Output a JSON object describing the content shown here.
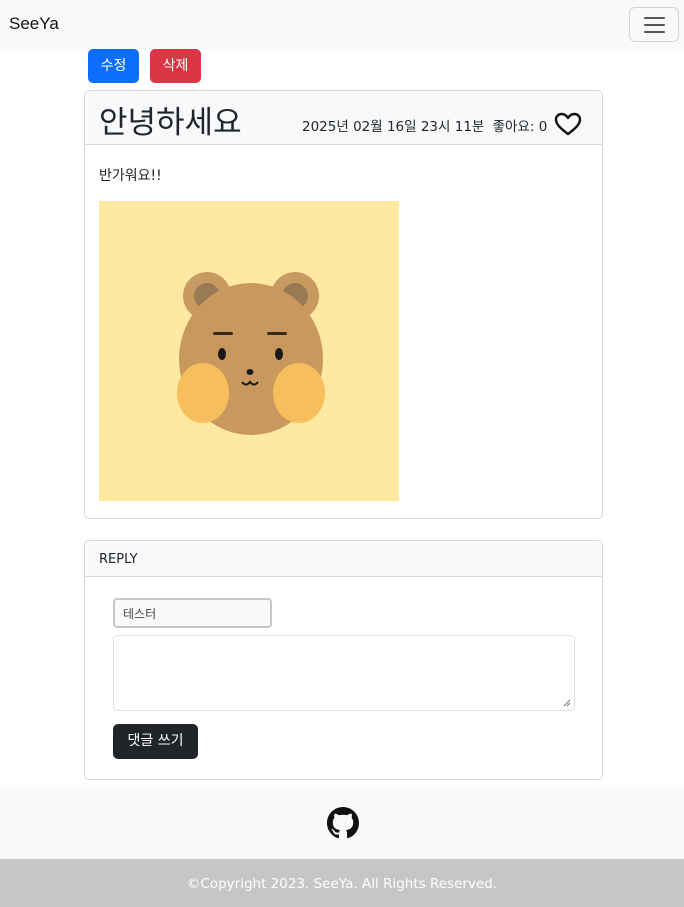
{
  "navbar": {
    "brand": "SeeYa",
    "toggler_icon": "hamburger-icon"
  },
  "actions": {
    "edit_label": "수정",
    "delete_label": "삭제"
  },
  "post": {
    "title": "안녕하세요",
    "date": "2025년 02월 16일 23시 11분",
    "likes_label": "좋아요:",
    "likes_count": "0",
    "like_icon": "heart-outline-icon",
    "content": "반가워요!!",
    "image": "bear-character-image"
  },
  "reply": {
    "header": "REPLY",
    "author_value": "테스터",
    "text_value": "",
    "submit_label": "댓글 쓰기"
  },
  "footer": {
    "github_icon": "github-icon",
    "copyright": "©Copyright 2023. SeeYa. All Rights Reserved."
  },
  "colors": {
    "primary": "#0d6efd",
    "danger": "#dc3545",
    "dark": "#212529",
    "light": "#f8f9fa",
    "footer_bottom": "#c4c6c8",
    "image_bg": "#ffe8a0"
  }
}
